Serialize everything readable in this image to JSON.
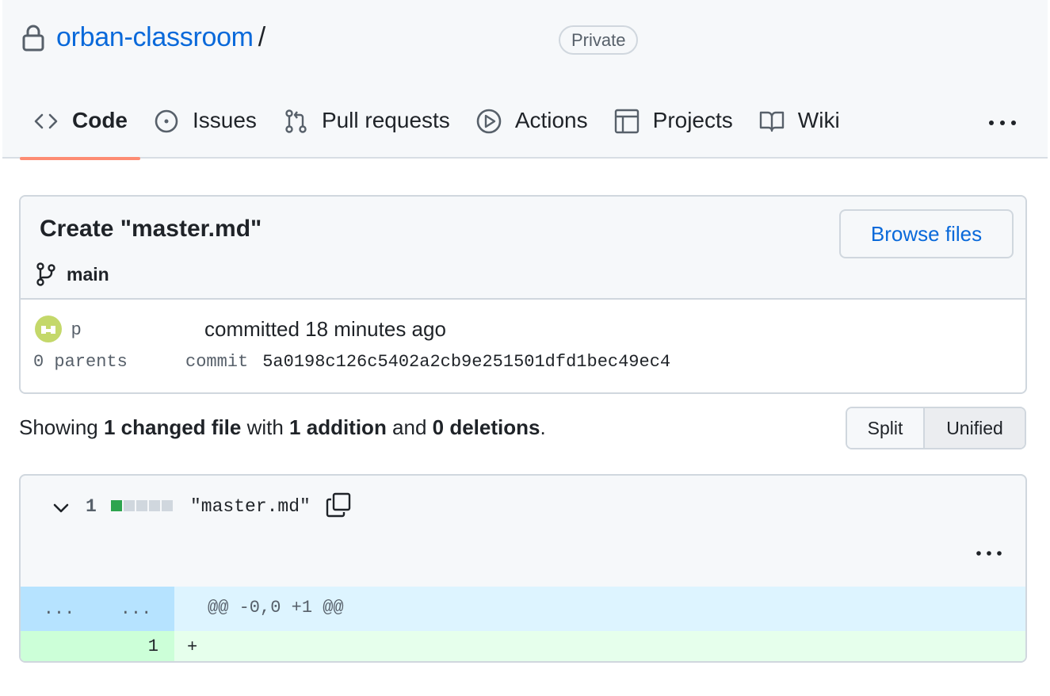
{
  "repo": {
    "owner": "orban-classroom",
    "separator": "/",
    "visibility": "Private"
  },
  "tabs": [
    {
      "label": "Code",
      "icon": "code-icon"
    },
    {
      "label": "Issues",
      "icon": "issue-icon"
    },
    {
      "label": "Pull requests",
      "icon": "pull-request-icon"
    },
    {
      "label": "Actions",
      "icon": "play-icon"
    },
    {
      "label": "Projects",
      "icon": "table-icon"
    },
    {
      "label": "Wiki",
      "icon": "book-icon"
    }
  ],
  "commit": {
    "title": "Create \"master.md\"",
    "browse_label": "Browse files",
    "branch": "main",
    "author": "p",
    "committed_text": "committed 18 minutes ago",
    "parents": "0 parents",
    "commit_label": "commit",
    "sha": "5a0198c126c5402a2cb9e251501dfd1bec49еc4"
  },
  "summary": {
    "prefix": "Showing ",
    "changed": "1 changed file",
    "with": " with ",
    "additions": "1 addition",
    "and": " and ",
    "deletions": "0 deletions",
    "end": "."
  },
  "view_toggle": {
    "split": "Split",
    "unified": "Unified",
    "selected": "Unified"
  },
  "file": {
    "changes": "1",
    "name": "\"master.md\"",
    "hunk_left": "...",
    "hunk_right": "...",
    "hunk_header": "@@ -0,0 +1 @@",
    "line_number": "1",
    "line_content": "+"
  },
  "colors": {
    "link": "#0969da",
    "active_tab_underline": "#fd8c73",
    "addition": "#2da44e"
  }
}
